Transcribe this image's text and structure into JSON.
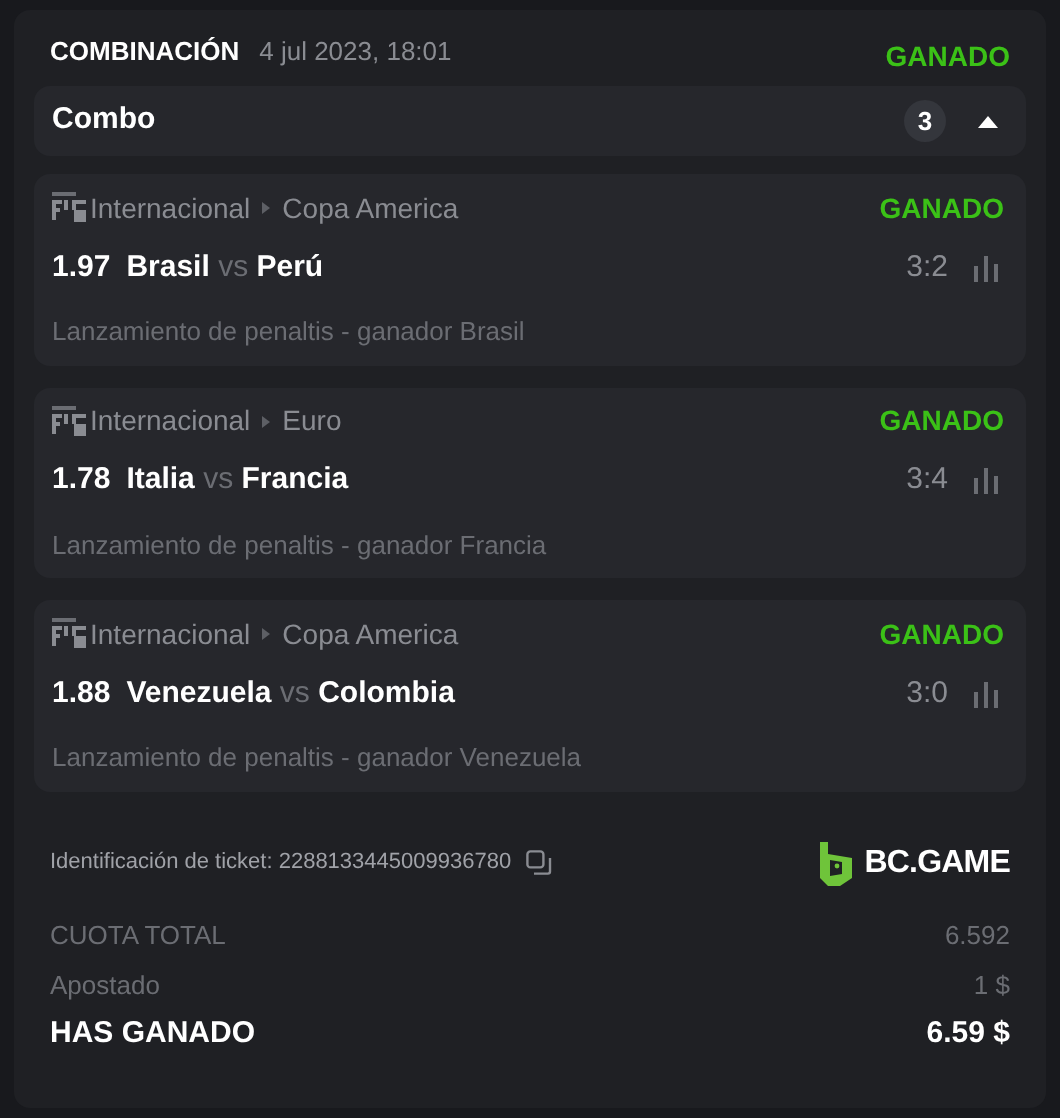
{
  "header": {
    "title": "COMBINACIÓN",
    "date": "4 jul 2023, 18:01",
    "status": "GANADO"
  },
  "combo": {
    "label": "Combo",
    "count": "3",
    "expanded": true
  },
  "legs": [
    {
      "category": "Internacional",
      "league": "Copa America",
      "status": "GANADO",
      "odds": "1.97",
      "home": "Brasil",
      "vs": "vs",
      "away": "Perú",
      "score": "3:2",
      "market": "Lanzamiento de penaltis - ganador Brasil"
    },
    {
      "category": "Internacional",
      "league": "Euro",
      "status": "GANADO",
      "odds": "1.78",
      "home": "Italia",
      "vs": "vs",
      "away": "Francia",
      "score": "3:4",
      "market": "Lanzamiento de penaltis - ganador Francia"
    },
    {
      "category": "Internacional",
      "league": "Copa America",
      "status": "GANADO",
      "odds": "1.88",
      "home": "Venezuela",
      "vs": "vs",
      "away": "Colombia",
      "score": "3:0",
      "market": "Lanzamiento de penaltis - ganador Venezuela"
    }
  ],
  "ticket": {
    "label": "Identificación de ticket: 2288133445009936780",
    "brand": "BC.GAME"
  },
  "summary": [
    {
      "label": "CUOTA TOTAL",
      "value": "6.592",
      "kind": "muted"
    },
    {
      "label": "Apostado",
      "value": "1 $",
      "kind": "muted"
    },
    {
      "label": "HAS GANADO",
      "value": "6.59 $",
      "kind": "strong"
    }
  ]
}
